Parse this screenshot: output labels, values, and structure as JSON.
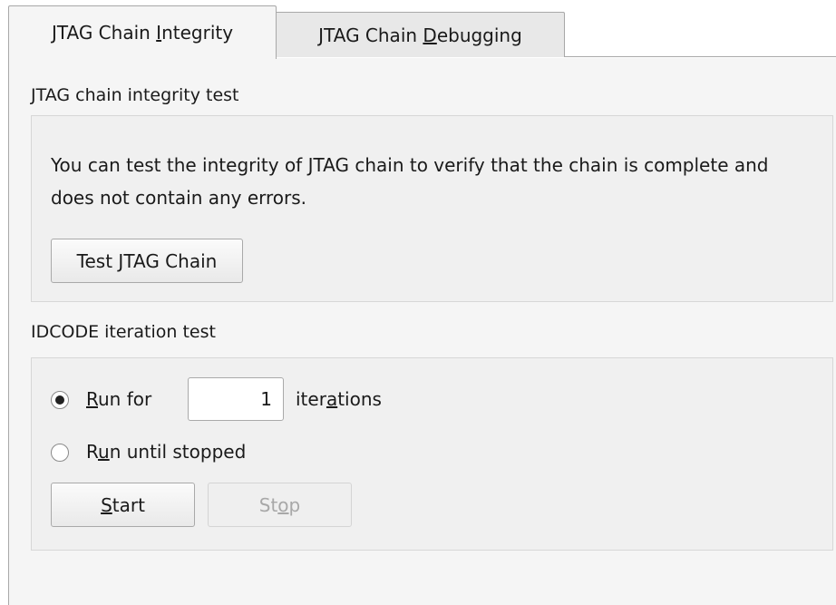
{
  "tabs": [
    {
      "label_pre": "JTAG Chain ",
      "mnemonic": "I",
      "label_post": "ntegrity",
      "active": true
    },
    {
      "label_pre": "JTAG Chain ",
      "mnemonic": "D",
      "label_post": "ebugging",
      "active": false
    }
  ],
  "integrity": {
    "title": "JTAG chain integrity test",
    "description": "You can test the integrity of JTAG chain to verify that the chain is complete and does not contain any errors.",
    "test_button": {
      "pre": "Test ",
      "mnemonic": "J",
      "post": "TAG Chain"
    }
  },
  "idcode": {
    "title": "IDCODE iteration test",
    "run_for": {
      "pre": "",
      "mnemonic": "R",
      "post": "un for",
      "selected": true
    },
    "iterations_value": "1",
    "iterations_label": {
      "pre": "iter",
      "mnemonic": "a",
      "post": "tions"
    },
    "run_until": {
      "pre": "R",
      "mnemonic": "u",
      "post": "n until stopped",
      "selected": false
    },
    "start_button": {
      "pre": "",
      "mnemonic": "S",
      "post": "tart",
      "enabled": true
    },
    "stop_button": {
      "pre": "St",
      "mnemonic": "o",
      "post": "p",
      "enabled": false
    }
  }
}
